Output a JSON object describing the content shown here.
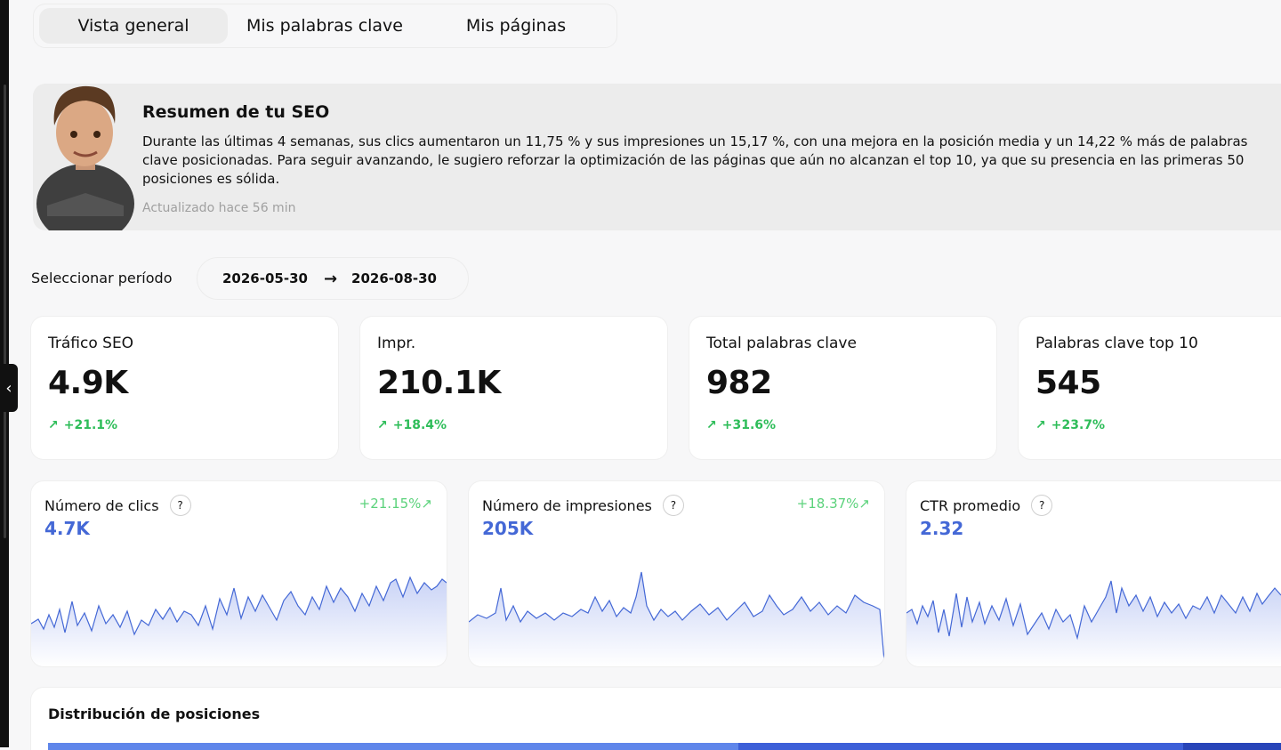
{
  "tabs": [
    {
      "label": "Vista general",
      "active": true
    },
    {
      "label": "Mis palabras clave",
      "active": false
    },
    {
      "label": "Mis páginas",
      "active": false
    }
  ],
  "summary": {
    "title": "Resumen de tu SEO",
    "text": "Durante las últimas 4 semanas, sus clics aumentaron un 11,75 % y sus impresiones un 15,17 %, con una mejora en la posición media y un 14,22 % más de palabras clave posicionadas. Para seguir avanzando, le sugiero reforzar la optimización de las páginas que aún no alcanzan el top 10, ya que su presencia en las primeras 50 posiciones es sólida.",
    "updated": "Actualizado hace 56 min"
  },
  "period": {
    "label": "Seleccionar período",
    "start": "2026-05-30",
    "arrow": "→",
    "end": "2026-08-30"
  },
  "stats": [
    {
      "label": "Tráfico SEO",
      "value": "4.9K",
      "change": "+21.1%"
    },
    {
      "label": "Impr.",
      "value": "210.1K",
      "change": "+18.4%"
    },
    {
      "label": "Total palabras clave",
      "value": "982",
      "change": "+31.6%"
    },
    {
      "label": "Palabras clave top 10",
      "value": "545",
      "change": "+23.7%"
    }
  ],
  "metrics": [
    {
      "title": "Número de clics",
      "value": "4.7K",
      "change": "+21.15%",
      "help": "?"
    },
    {
      "title": "Número de impresiones",
      "value": "205K",
      "change": "+18.37%",
      "help": "?"
    },
    {
      "title": "CTR promedio",
      "value": "2.32",
      "change": "",
      "help": "?"
    }
  ],
  "distribution": {
    "title": "Distribución de posiciones"
  },
  "icons": {
    "collapse": "chevron-left-icon",
    "trend": "trend-up-arrow-icon",
    "help": "help-icon"
  },
  "colors": {
    "positive": "#2ebd59",
    "metric_value": "#4468d6",
    "sparkline": "#4468d6",
    "panel": "#ececec"
  }
}
